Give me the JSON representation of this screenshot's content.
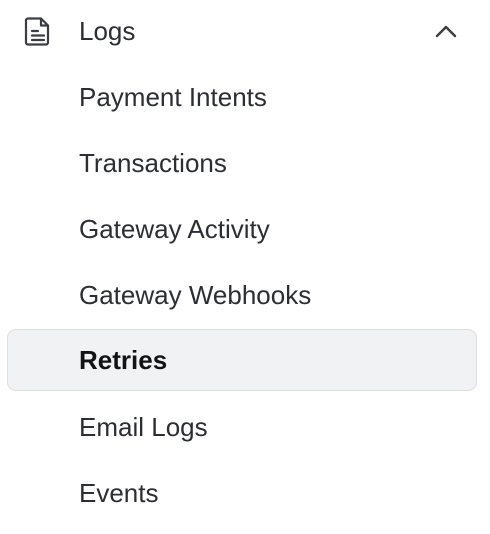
{
  "section": {
    "title": "Logs",
    "icon": "document-icon",
    "toggle_icon": "chevron-up-icon",
    "expanded": true
  },
  "items": [
    {
      "label": "Payment Intents",
      "active": false
    },
    {
      "label": "Transactions",
      "active": false
    },
    {
      "label": "Gateway Activity",
      "active": false
    },
    {
      "label": "Gateway Webhooks",
      "active": false
    },
    {
      "label": "Retries",
      "active": true
    },
    {
      "label": "Email Logs",
      "active": false
    },
    {
      "label": "Events",
      "active": false
    }
  ],
  "colors": {
    "text": "#2b2e33",
    "active_text": "#111315",
    "active_background": "#f1f2f4",
    "active_border": "#dcdee2",
    "icon": "#3a3d42"
  }
}
